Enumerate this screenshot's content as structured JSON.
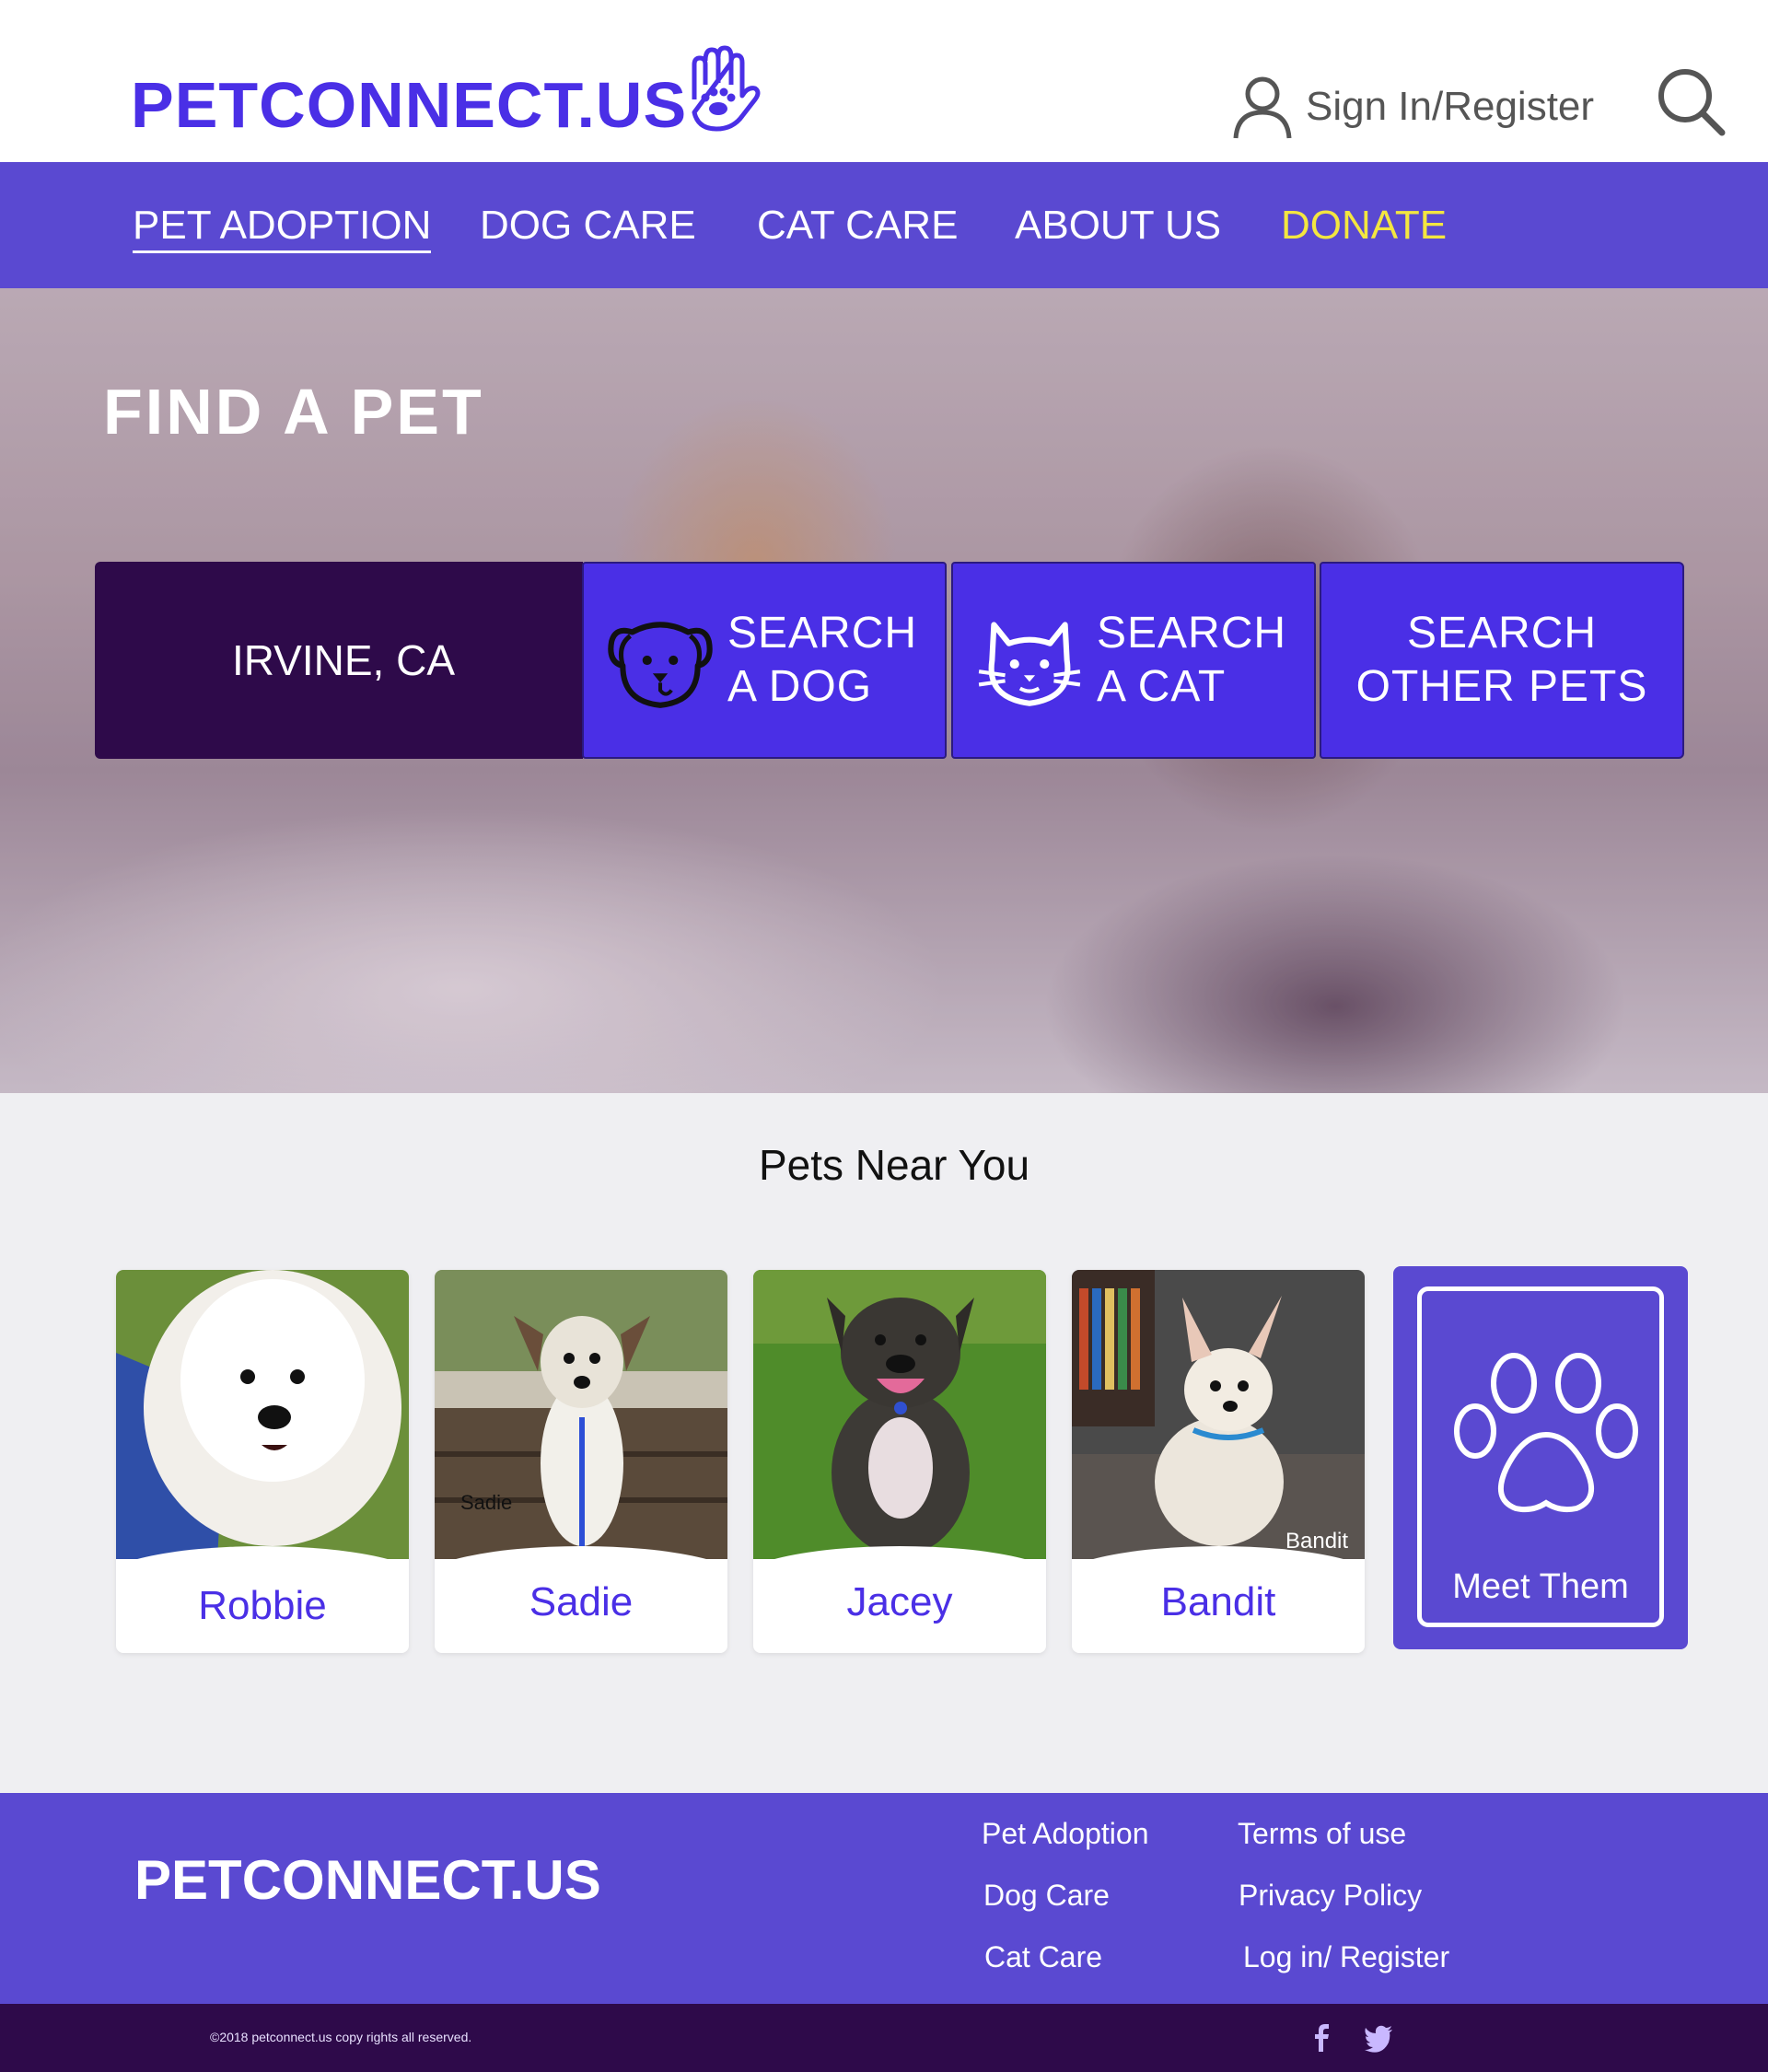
{
  "header": {
    "logo": "PETCONNECT.US",
    "signin_label": "Sign In/Register"
  },
  "nav": {
    "items": [
      {
        "label": "PET ADOPTION"
      },
      {
        "label": "DOG CARE"
      },
      {
        "label": "CAT CARE"
      },
      {
        "label": "ABOUT US"
      },
      {
        "label": "DONATE"
      }
    ]
  },
  "hero": {
    "title": "FIND A PET",
    "location": "IRVINE, CA",
    "search_dog": {
      "line1": "SEARCH",
      "line2": "A DOG"
    },
    "search_cat": {
      "line1": "SEARCH",
      "line2": "A CAT"
    },
    "search_other": {
      "line1": "SEARCH",
      "line2": "OTHER PETS"
    }
  },
  "pets_section": {
    "title": "Pets Near You",
    "pets": [
      {
        "name": "Robbie"
      },
      {
        "name": "Sadie",
        "photo_caption": "Sadie"
      },
      {
        "name": "Jacey"
      },
      {
        "name": "Bandit",
        "photo_caption": "Bandit"
      }
    ],
    "meet_label": "Meet Them"
  },
  "footer": {
    "logo": "PETCONNECT.US",
    "links_col1": [
      "Pet Adoption",
      "Dog Care",
      "Cat Care"
    ],
    "links_col2": [
      "Terms of use",
      "Privacy Policy",
      "Log in/ Register"
    ],
    "copyright": "©2018  petconnect.us copy rights all reserved."
  },
  "colors": {
    "brand_purple": "#4a2fe6",
    "nav_purple": "#5a49d1",
    "dark_purple": "#2e0a4a",
    "donate_yellow": "#f3e640"
  },
  "icons": [
    "hand-paw-icon",
    "user-icon",
    "search-icon",
    "dog-icon",
    "cat-icon",
    "paw-icon",
    "facebook-icon",
    "twitter-icon"
  ]
}
